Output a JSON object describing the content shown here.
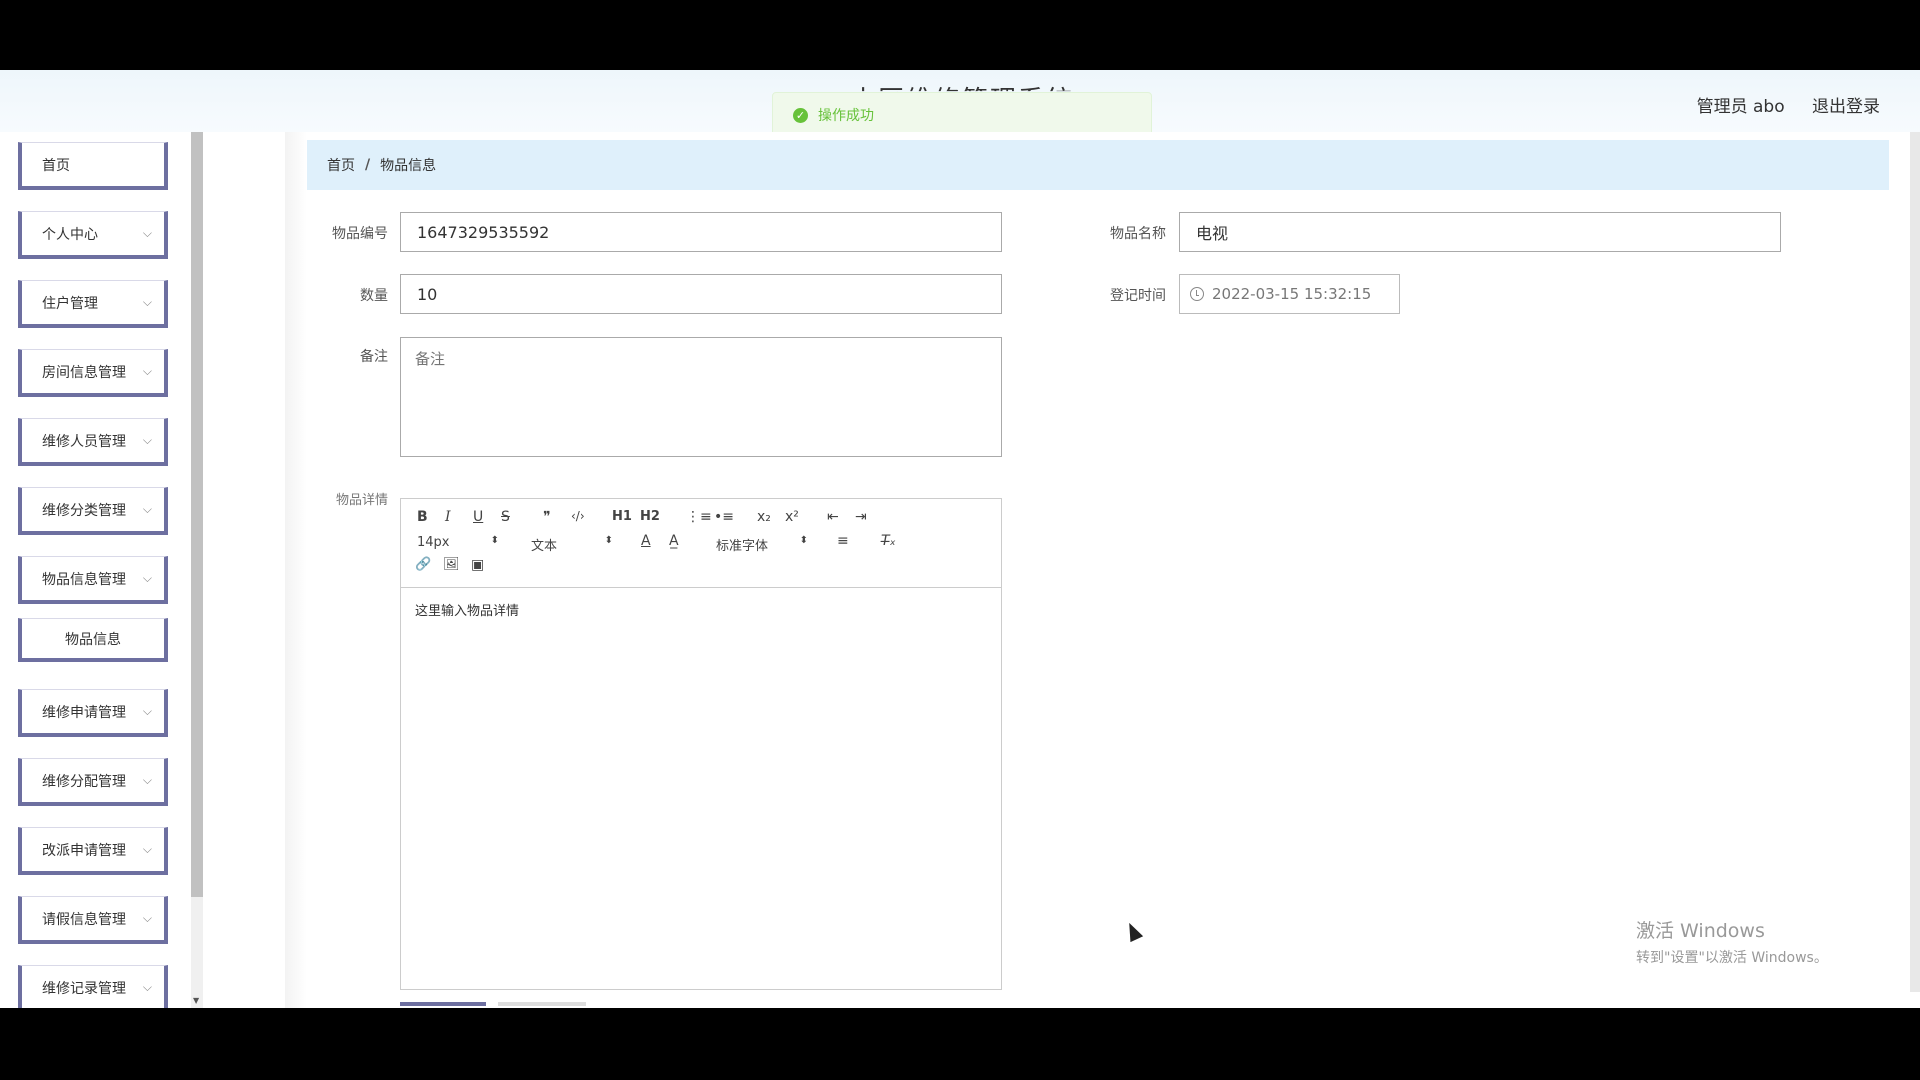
{
  "header": {
    "title": "小区维修管理系统",
    "user": "管理员 abo",
    "logout": "退出登录"
  },
  "toast": {
    "message": "操作成功",
    "icon": "check-circle-icon"
  },
  "sidebar": {
    "items": [
      {
        "label": "首页",
        "has_arrow": false
      },
      {
        "label": "个人中心",
        "has_arrow": true
      },
      {
        "label": "住户管理",
        "has_arrow": true
      },
      {
        "label": "房间信息管理",
        "has_arrow": true
      },
      {
        "label": "维修人员管理",
        "has_arrow": true
      },
      {
        "label": "维修分类管理",
        "has_arrow": true
      },
      {
        "label": "物品信息管理",
        "has_arrow": true
      },
      {
        "label": "物品信息",
        "has_arrow": false,
        "sub": true
      },
      {
        "label": "维修申请管理",
        "has_arrow": true
      },
      {
        "label": "维修分配管理",
        "has_arrow": true
      },
      {
        "label": "改派申请管理",
        "has_arrow": true
      },
      {
        "label": "请假信息管理",
        "has_arrow": true
      },
      {
        "label": "维修记录管理",
        "has_arrow": true
      }
    ],
    "arrow": "⌵"
  },
  "breadcrumb": {
    "home": "首页",
    "sep": "/",
    "current": "物品信息"
  },
  "form": {
    "item_no_label": "物品编号",
    "item_no_value": "1647329535592",
    "item_name_label": "物品名称",
    "item_name_value": "电视",
    "quantity_label": "数量",
    "quantity_value": "10",
    "register_time_label": "登记时间",
    "register_time_value": "2022-03-15 15:32:15",
    "remark_label": "备注",
    "remark_placeholder": "备注",
    "detail_label": "物品详情",
    "detail_placeholder": "这里输入物品详情"
  },
  "editor": {
    "font_size": "14px",
    "heading_select": "文本",
    "font_family": "标准字体",
    "h1": "H1",
    "h2": "H2",
    "quote": "❞",
    "code": "‹/›",
    "ol": "⋮≡",
    "ul": "•≡",
    "sub": "x₂",
    "sup": "x²",
    "outdent": "⇤",
    "indent": "⇥",
    "color": "A",
    "bg": "A̲",
    "align": "≡",
    "clean": "T̶ₓ",
    "link": "🔗",
    "image": "🖼",
    "video": "▣",
    "bold": "B",
    "italic": "I",
    "underline": "U",
    "strike": "S"
  },
  "watermark": {
    "line1": "激活 Windows",
    "line2": "转到\"设置\"以激活 Windows。"
  }
}
